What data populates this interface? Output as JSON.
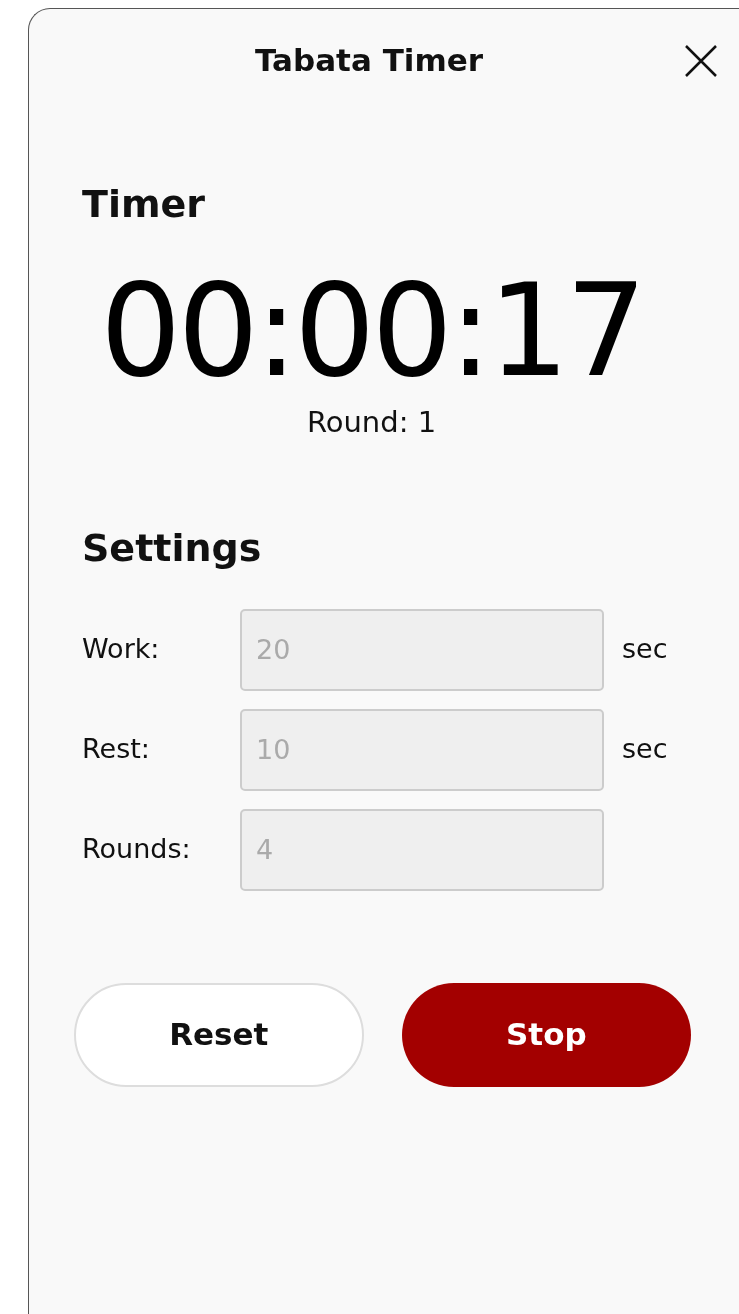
{
  "window": {
    "title": "Tabata Timer"
  },
  "timer": {
    "heading": "Timer",
    "time": "00:00:17",
    "round": "Round: 1"
  },
  "settings": {
    "heading": "Settings",
    "fields": [
      {
        "label": "Work:",
        "value": "20",
        "unit": "sec",
        "disabled": true
      },
      {
        "label": "Rest:",
        "value": "10",
        "unit": "sec",
        "disabled": true
      },
      {
        "label": "Rounds:",
        "value": "4",
        "disabled": true
      }
    ]
  },
  "buttons": [
    {
      "label": "Reset",
      "kind": "secondary"
    },
    {
      "label": "Stop",
      "kind": "primary"
    }
  ]
}
